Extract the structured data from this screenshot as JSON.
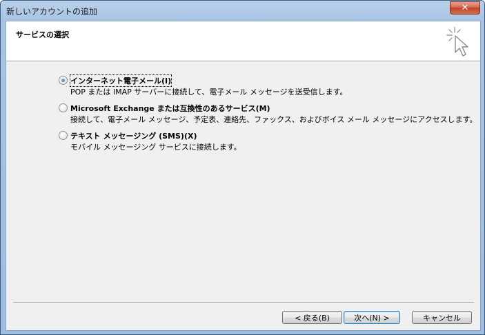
{
  "window": {
    "title": "新しいアカウントの追加",
    "close_symbol": "✕"
  },
  "header": {
    "title": "サービスの選択",
    "icon": "sparkle-cursor-icon"
  },
  "options": [
    {
      "label": "インターネット電子メール(I)",
      "description": "POP または IMAP サーバーに接続して、電子メール メッセージを送受信します。",
      "selected": true
    },
    {
      "label": "Microsoft Exchange または互換性のあるサービス(M)",
      "description": "接続して、電子メール メッセージ、予定表、連絡先、ファックス、およびボイス メール メッセージにアクセスします。",
      "selected": false
    },
    {
      "label": "テキスト メッセージング (SMS)(X)",
      "description": "モバイル メッセージング サービスに接続します。",
      "selected": false
    }
  ],
  "buttons": {
    "back": "< 戻る(B)",
    "next": "次へ(N) >",
    "cancel": "キャンセル"
  }
}
